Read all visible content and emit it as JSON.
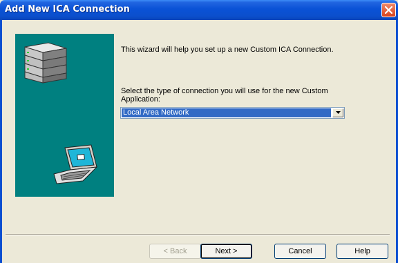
{
  "window": {
    "title": "Add New ICA Connection",
    "close_icon": "close-icon"
  },
  "wizard": {
    "intro_text": "This wizard will help you set up a new Custom ICA Connection.",
    "prompt_text": "Select the type of connection you will use for the new Custom Application:",
    "connection_type": {
      "selected": "Local Area Network"
    },
    "panel_color": "#008080",
    "selection_color": "#316ac5"
  },
  "buttons": {
    "back": "< Back",
    "next": "Next >",
    "cancel": "Cancel",
    "help": "Help"
  },
  "icons": [
    "server-stack-icon",
    "laptop-icon",
    "dropdown-arrow-icon",
    "close-icon"
  ]
}
